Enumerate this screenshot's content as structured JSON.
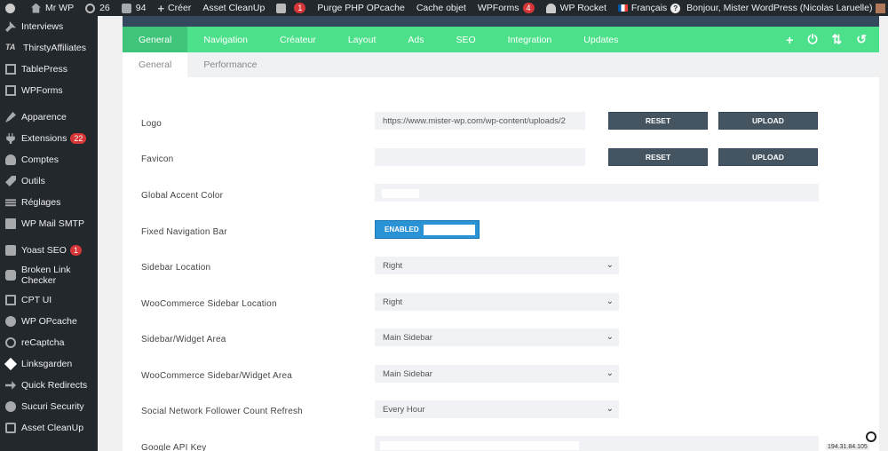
{
  "adminbar": {
    "site_name": "Mr WP",
    "updates_count": "26",
    "comments_count": "94",
    "new_label": "Créer",
    "asset_cleanup": "Asset CleanUp",
    "yoast_badge": "1",
    "purge_opcache": "Purge PHP OPcache",
    "cache_objet": "Cache objet",
    "wpforms": "WPForms",
    "wpforms_badge": "4",
    "wp_rocket": "WP Rocket",
    "language": "Français",
    "greeting": "Bonjour, Mister WordPress (Nicolas Laruelle)"
  },
  "sidebar": {
    "items": [
      {
        "label": "Interviews"
      },
      {
        "label": "ThirstyAffiliates"
      },
      {
        "label": "TablePress"
      },
      {
        "label": "WPForms"
      },
      {
        "label": "Apparence"
      },
      {
        "label": "Extensions",
        "badge": "22"
      },
      {
        "label": "Comptes"
      },
      {
        "label": "Outils"
      },
      {
        "label": "Réglages"
      },
      {
        "label": "WP Mail SMTP"
      },
      {
        "label": "Yoast SEO",
        "badge": "1"
      },
      {
        "label": "Broken Link Checker"
      },
      {
        "label": "CPT UI"
      },
      {
        "label": "WP OPcache"
      },
      {
        "label": "reCaptcha"
      },
      {
        "label": "Linksgarden"
      },
      {
        "label": "Quick Redirects"
      },
      {
        "label": "Sucuri Security"
      },
      {
        "label": "Asset CleanUp"
      }
    ]
  },
  "tabs": [
    "General",
    "Navigation",
    "Créateur",
    "Layout",
    "Ads",
    "SEO",
    "Integration",
    "Updates"
  ],
  "sub_tabs": [
    "General",
    "Performance"
  ],
  "nav_icons": {
    "add": "+",
    "power": "⏻",
    "sort": "⇅",
    "undo": "↺"
  },
  "form": {
    "logo": {
      "label": "Logo",
      "value": "https://www.mister-wp.com/wp-content/uploads/2",
      "reset": "RESET",
      "upload": "UPLOAD"
    },
    "favicon": {
      "label": "Favicon",
      "value": "",
      "reset": "RESET",
      "upload": "UPLOAD"
    },
    "accent": {
      "label": "Global Accent Color"
    },
    "fixed_nav": {
      "label": "Fixed Navigation Bar",
      "state": "ENABLED"
    },
    "sidebar_location": {
      "label": "Sidebar Location",
      "value": "Right"
    },
    "woo_sidebar_location": {
      "label": "WooCommerce Sidebar Location",
      "value": "Right"
    },
    "sidebar_area": {
      "label": "Sidebar/Widget Area",
      "value": "Main Sidebar"
    },
    "woo_sidebar_area": {
      "label": "WooCommerce Sidebar/Widget Area",
      "value": "Main Sidebar"
    },
    "social_refresh": {
      "label": "Social Network Follower Count Refresh",
      "value": "Every Hour"
    },
    "google_api": {
      "label": "Google API Key",
      "value": ""
    }
  },
  "ip_text": "194.31.84.105"
}
